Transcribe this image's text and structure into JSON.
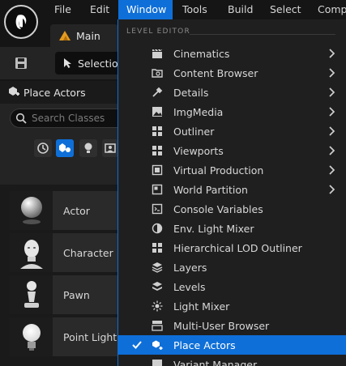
{
  "menubar": {
    "items": [
      "File",
      "Edit",
      "Window",
      "Tools",
      "Build",
      "Select",
      "Comp"
    ],
    "active": "Window"
  },
  "tab": {
    "label": "Main"
  },
  "toolbar": {
    "selection_label": "Selectio"
  },
  "place_actors": {
    "title": "Place Actors",
    "search_placeholder": "Search Classes",
    "categories": [
      "recently-placed-icon",
      "basic-shapes-icon",
      "lights-icon",
      "cinematic-icon"
    ],
    "actors": [
      {
        "label": "Actor",
        "icon": "sphere-icon"
      },
      {
        "label": "Character",
        "icon": "mannequin-head-icon"
      },
      {
        "label": "Pawn",
        "icon": "pawn-icon"
      },
      {
        "label": "Point Light",
        "icon": "lightbulb-icon"
      }
    ]
  },
  "window_menu": {
    "section": "LEVEL EDITOR",
    "items": [
      {
        "label": "Cinematics",
        "submenu": true,
        "icon": "clapper-icon"
      },
      {
        "label": "Content Browser",
        "submenu": true,
        "icon": "content-browser-icon"
      },
      {
        "label": "Details",
        "submenu": true,
        "icon": "details-icon"
      },
      {
        "label": "ImgMedia",
        "submenu": true,
        "icon": "image-media-icon"
      },
      {
        "label": "Outliner",
        "submenu": true,
        "icon": "outliner-icon"
      },
      {
        "label": "Viewports",
        "submenu": true,
        "icon": "viewports-icon"
      },
      {
        "label": "Virtual Production",
        "submenu": true,
        "icon": "virtual-production-icon"
      },
      {
        "label": "World Partition",
        "submenu": true,
        "icon": "world-partition-icon"
      },
      {
        "label": "Console Variables",
        "submenu": false,
        "icon": "console-variables-icon"
      },
      {
        "label": "Env. Light Mixer",
        "submenu": false,
        "icon": "env-light-mixer-icon"
      },
      {
        "label": "Hierarchical LOD Outliner",
        "submenu": false,
        "icon": "hlod-icon"
      },
      {
        "label": "Layers",
        "submenu": false,
        "icon": "layers-icon"
      },
      {
        "label": "Levels",
        "submenu": false,
        "icon": "levels-icon"
      },
      {
        "label": "Light Mixer",
        "submenu": false,
        "icon": "light-mixer-icon"
      },
      {
        "label": "Multi-User Browser",
        "submenu": false,
        "icon": "multi-user-icon"
      },
      {
        "label": "Place Actors",
        "submenu": false,
        "icon": "place-actors-icon",
        "checked": true,
        "highlighted": true
      },
      {
        "label": "Variant Manager",
        "submenu": false,
        "icon": "variant-manager-icon"
      }
    ]
  },
  "colors": {
    "accent": "#0e6fd8",
    "background": "#151515",
    "panel": "#242424",
    "menu": "#1f1f1f"
  }
}
